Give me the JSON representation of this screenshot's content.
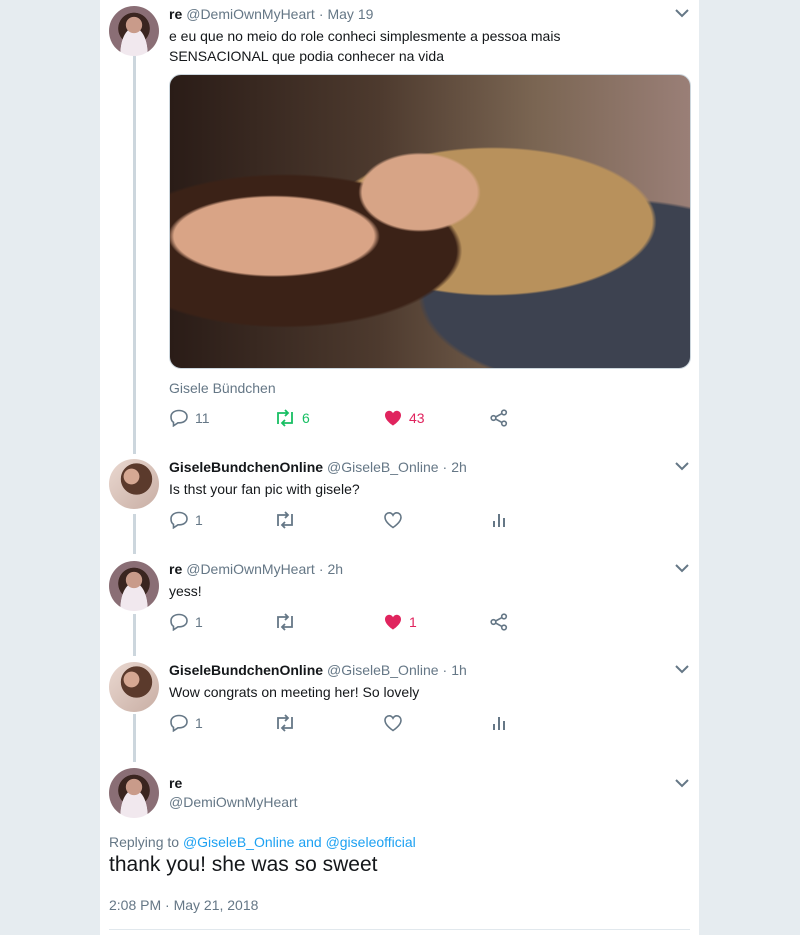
{
  "tweets": [
    {
      "name": "re",
      "handle": "@DemiOwnMyHeart",
      "time": "May 19",
      "text_line1": "e eu que no meio do role conheci simplesmente a pessoa mais",
      "text_line2": "SENSACIONAL que podia conhecer na vida",
      "caption": "Gisele Bündchen",
      "replies": "11",
      "retweets": "6",
      "likes": "43"
    },
    {
      "name": "GiseleBundchenOnline",
      "handle": "@GiseleB_Online",
      "time": "2h",
      "text": "Is thst your fan pic with gisele?",
      "replies": "1"
    },
    {
      "name": "re",
      "handle": "@DemiOwnMyHeart",
      "time": "2h",
      "text": "yess!",
      "replies": "1",
      "likes": "1"
    },
    {
      "name": "GiseleBundchenOnline",
      "handle": "@GiseleB_Online",
      "time": "1h",
      "text": "Wow congrats on meeting her! So lovely",
      "replies": "1"
    }
  ],
  "main": {
    "name": "re",
    "handle": "@DemiOwnMyHeart",
    "replying_prefix": "Replying to",
    "replying_to": "@GiseleB_Online and @giseleofficial",
    "text": "thank you! she was so sweet",
    "timestamp": "2:08 PM · May 21, 2018"
  },
  "separator": "·",
  "colors": {
    "retweet_active": "#17bf63",
    "like_active": "#e0245e",
    "link": "#1da1f2",
    "muted": "#657786"
  },
  "icons": [
    "chevron-down-icon",
    "reply-icon",
    "retweet-icon",
    "heart-icon",
    "share-icon",
    "analytics-icon"
  ]
}
